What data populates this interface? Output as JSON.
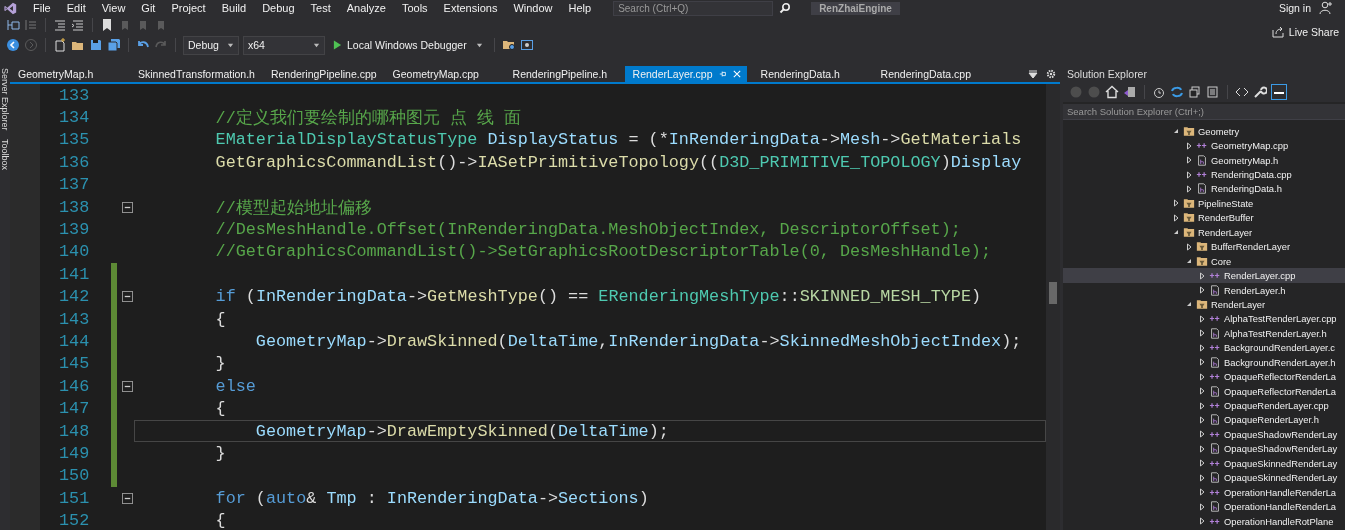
{
  "menu": [
    "File",
    "Edit",
    "View",
    "Git",
    "Project",
    "Build",
    "Debug",
    "Test",
    "Analyze",
    "Tools",
    "Extensions",
    "Window",
    "Help"
  ],
  "search": {
    "placeholder": "Search (Ctrl+Q)"
  },
  "solution_name": "RenZhaiEngine",
  "sign_in": "Sign in",
  "live_share": "Live Share",
  "toolbar": {
    "configuration": "Debug",
    "platform": "x64",
    "run_label": "Local Windows Debugger"
  },
  "side_tabs": [
    "Server Explorer",
    "Toolbox"
  ],
  "tabs": [
    {
      "label": "GeometryMap.h",
      "selected": false
    },
    {
      "label": "SkinnedTransformation.h",
      "selected": false
    },
    {
      "label": "RenderingPipeline.cpp",
      "selected": false
    },
    {
      "label": "GeometryMap.cpp",
      "selected": false
    },
    {
      "label": "RenderingPipeline.h",
      "selected": false
    },
    {
      "label": "RenderLayer.cpp",
      "selected": true
    },
    {
      "label": "RenderingData.h",
      "selected": false
    },
    {
      "label": "RenderingData.cpp",
      "selected": false
    }
  ],
  "lines": [
    {
      "number": "133",
      "changed": false,
      "fold": false,
      "current": false
    },
    {
      "number": "134",
      "changed": false,
      "fold": false,
      "current": false,
      "tokens": [
        {
          "text": "        //定义我们要绘制的哪种图元 点 线 面",
          "kind": "comment"
        }
      ]
    },
    {
      "number": "135",
      "changed": false,
      "fold": false,
      "current": false,
      "tokens": [
        {
          "text": "        EMaterialDisplayStatusType",
          "kind": "type"
        },
        {
          "text": " DisplayStatus",
          "kind": "var"
        },
        {
          "text": " = (*",
          "kind": "plain"
        },
        {
          "text": "InRenderingData",
          "kind": "var"
        },
        {
          "text": "->",
          "kind": "plain"
        },
        {
          "text": "Mesh",
          "kind": "var"
        },
        {
          "text": "->",
          "kind": "plain"
        },
        {
          "text": "GetMaterials",
          "kind": "func"
        }
      ]
    },
    {
      "number": "136",
      "changed": false,
      "fold": false,
      "current": false,
      "tokens": [
        {
          "text": "        GetGraphicsCommandList",
          "kind": "func"
        },
        {
          "text": "()->",
          "kind": "plain"
        },
        {
          "text": "IASetPrimitiveTopology",
          "kind": "func"
        },
        {
          "text": "((",
          "kind": "plain"
        },
        {
          "text": "D3D_PRIMITIVE_TOPOLOGY",
          "kind": "type"
        },
        {
          "text": ")",
          "kind": "plain"
        },
        {
          "text": "Display",
          "kind": "var"
        }
      ]
    },
    {
      "number": "137",
      "changed": false,
      "fold": false,
      "current": false
    },
    {
      "number": "138",
      "changed": false,
      "fold": true,
      "current": false,
      "tokens": [
        {
          "text": "        //模型起始地址偏移",
          "kind": "comment"
        }
      ]
    },
    {
      "number": "139",
      "changed": false,
      "fold": false,
      "current": false,
      "tokens": [
        {
          "text": "        //DesMeshHandle.Offset(InRenderingData.MeshObjectIndex, DescriptorOffset);",
          "kind": "comment"
        }
      ]
    },
    {
      "number": "140",
      "changed": false,
      "fold": false,
      "current": false,
      "tokens": [
        {
          "text": "        //GetGraphicsCommandList()->SetGraphicsRootDescriptorTable(0, DesMeshHandle);",
          "kind": "comment"
        }
      ]
    },
    {
      "number": "141",
      "changed": true,
      "fold": false,
      "current": false
    },
    {
      "number": "142",
      "changed": true,
      "fold": true,
      "current": false,
      "tokens": [
        {
          "text": "        if",
          "kind": "keyword"
        },
        {
          "text": " (",
          "kind": "plain"
        },
        {
          "text": "InRenderingData",
          "kind": "var"
        },
        {
          "text": "->",
          "kind": "plain"
        },
        {
          "text": "GetMeshType",
          "kind": "func"
        },
        {
          "text": "() == ",
          "kind": "plain"
        },
        {
          "text": "ERenderingMeshType",
          "kind": "type"
        },
        {
          "text": "::",
          "kind": "plain"
        },
        {
          "text": "SKINNED_MESH_TYPE",
          "kind": "enum"
        },
        {
          "text": ")",
          "kind": "plain"
        }
      ]
    },
    {
      "number": "143",
      "changed": true,
      "fold": false,
      "current": false,
      "tokens": [
        {
          "text": "        {",
          "kind": "plain"
        }
      ]
    },
    {
      "number": "144",
      "changed": true,
      "fold": false,
      "current": false,
      "tokens": [
        {
          "text": "            GeometryMap",
          "kind": "var"
        },
        {
          "text": "->",
          "kind": "plain"
        },
        {
          "text": "DrawSkinned",
          "kind": "func"
        },
        {
          "text": "(",
          "kind": "plain"
        },
        {
          "text": "DeltaTime",
          "kind": "var"
        },
        {
          "text": ",",
          "kind": "plain"
        },
        {
          "text": "InRenderingData",
          "kind": "var"
        },
        {
          "text": "->",
          "kind": "plain"
        },
        {
          "text": "SkinnedMeshObjectIndex",
          "kind": "var"
        },
        {
          "text": ");",
          "kind": "plain"
        }
      ]
    },
    {
      "number": "145",
      "changed": true,
      "fold": false,
      "current": false,
      "tokens": [
        {
          "text": "        }",
          "kind": "plain"
        }
      ]
    },
    {
      "number": "146",
      "changed": true,
      "fold": true,
      "current": false,
      "tokens": [
        {
          "text": "        else",
          "kind": "keyword"
        }
      ]
    },
    {
      "number": "147",
      "changed": true,
      "fold": false,
      "current": false,
      "tokens": [
        {
          "text": "        {",
          "kind": "plain"
        }
      ]
    },
    {
      "number": "148",
      "changed": true,
      "fold": false,
      "current": true,
      "tokens": [
        {
          "text": "            GeometryMap",
          "kind": "var"
        },
        {
          "text": "->",
          "kind": "plain"
        },
        {
          "text": "DrawEmptySkinned",
          "kind": "func"
        },
        {
          "text": "(",
          "kind": "plain"
        },
        {
          "text": "DeltaTime",
          "kind": "var"
        },
        {
          "text": ");",
          "kind": "plain"
        }
      ]
    },
    {
      "number": "149",
      "changed": true,
      "fold": false,
      "current": false,
      "tokens": [
        {
          "text": "        }",
          "kind": "plain"
        }
      ]
    },
    {
      "number": "150",
      "changed": true,
      "fold": false,
      "current": false
    },
    {
      "number": "151",
      "changed": false,
      "fold": true,
      "current": false,
      "tokens": [
        {
          "text": "        for",
          "kind": "keyword"
        },
        {
          "text": " (",
          "kind": "plain"
        },
        {
          "text": "auto",
          "kind": "keyword"
        },
        {
          "text": "& ",
          "kind": "plain"
        },
        {
          "text": "Tmp",
          "kind": "var"
        },
        {
          "text": " : ",
          "kind": "plain"
        },
        {
          "text": "InRenderingData",
          "kind": "var"
        },
        {
          "text": "->",
          "kind": "plain"
        },
        {
          "text": "Sections",
          "kind": "var"
        },
        {
          "text": ")",
          "kind": "plain"
        }
      ]
    },
    {
      "number": "152",
      "changed": false,
      "fold": false,
      "current": false,
      "tokens": [
        {
          "text": "        {",
          "kind": "plain"
        }
      ]
    }
  ],
  "solution_explorer": {
    "title": "Solution Explorer",
    "search": {
      "placeholder": "Search Solution Explorer (Ctrl+;)"
    },
    "tree": [
      {
        "label": "Geometry",
        "kind": "folder",
        "expanded": true,
        "selected": false,
        "children": [
          {
            "label": "GeometryMap.cpp",
            "kind": "cpp",
            "expanded": false,
            "selected": false
          },
          {
            "label": "GeometryMap.h",
            "kind": "h",
            "expanded": false,
            "selected": false
          },
          {
            "label": "RenderingData.cpp",
            "kind": "cpp",
            "expanded": false,
            "selected": false
          },
          {
            "label": "RenderingData.h",
            "kind": "h",
            "expanded": false,
            "selected": false
          }
        ]
      },
      {
        "label": "PipelineState",
        "kind": "folder",
        "expanded": false,
        "selected": false
      },
      {
        "label": "RenderBuffer",
        "kind": "folder",
        "expanded": false,
        "selected": false
      },
      {
        "label": "RenderLayer",
        "kind": "folder",
        "expanded": true,
        "selected": false,
        "children": [
          {
            "label": "BufferRenderLayer",
            "kind": "folder",
            "expanded": false,
            "selected": false
          },
          {
            "label": "Core",
            "kind": "folder",
            "expanded": true,
            "selected": false,
            "children": [
              {
                "label": "RenderLayer.cpp",
                "kind": "cpp",
                "expanded": false,
                "selected": true
              },
              {
                "label": "RenderLayer.h",
                "kind": "h",
                "expanded": false,
                "selected": false
              }
            ]
          },
          {
            "label": "RenderLayer",
            "kind": "folder",
            "expanded": true,
            "selected": false,
            "children": [
              {
                "label": "AlphaTestRenderLayer.cpp",
                "kind": "cpp",
                "expanded": false,
                "selected": false
              },
              {
                "label": "AlphaTestRenderLayer.h",
                "kind": "h",
                "expanded": false,
                "selected": false
              },
              {
                "label": "BackgroundRenderLayer.c",
                "kind": "cpp",
                "expanded": false,
                "selected": false
              },
              {
                "label": "BackgroundRenderLayer.h",
                "kind": "h",
                "expanded": false,
                "selected": false
              },
              {
                "label": "OpaqueReflectorRenderLa",
                "kind": "cpp",
                "expanded": false,
                "selected": false
              },
              {
                "label": "OpaqueReflectorRenderLa",
                "kind": "h",
                "expanded": false,
                "selected": false
              },
              {
                "label": "OpaqueRenderLayer.cpp",
                "kind": "cpp",
                "expanded": false,
                "selected": false
              },
              {
                "label": "OpaqueRenderLayer.h",
                "kind": "h",
                "expanded": false,
                "selected": false
              },
              {
                "label": "OpaqueShadowRenderLay",
                "kind": "cpp",
                "expanded": false,
                "selected": false
              },
              {
                "label": "OpaqueShadowRenderLay",
                "kind": "h",
                "expanded": false,
                "selected": false
              },
              {
                "label": "OpaqueSkinnedRenderLay",
                "kind": "cpp",
                "expanded": false,
                "selected": false
              },
              {
                "label": "OpaqueSkinnedRenderLay",
                "kind": "h",
                "expanded": false,
                "selected": false
              },
              {
                "label": "OperationHandleRenderLa",
                "kind": "cpp",
                "expanded": false,
                "selected": false
              },
              {
                "label": "OperationHandleRenderLa",
                "kind": "h",
                "expanded": false,
                "selected": false
              },
              {
                "label": "OperationHandleRotPlane",
                "kind": "cpp",
                "expanded": false,
                "selected": false
              }
            ]
          }
        ]
      }
    ]
  }
}
